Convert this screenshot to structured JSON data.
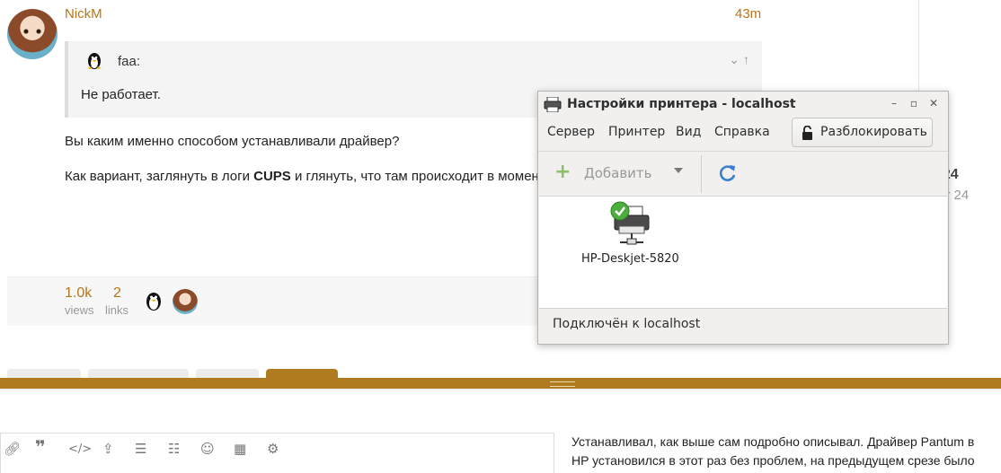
{
  "post": {
    "username": "NickM",
    "time": "43m",
    "quote_author": "faa:",
    "quote_text": "Не работает.",
    "paragraph1": "Вы каким именно способом устанавливали драйвер?",
    "paragraph2_before": "Как вариант, заглянуть в логи ",
    "paragraph2_bold": "CUPS",
    "paragraph2_after": " и глянуть, что там происходит в момент"
  },
  "timeline": {
    "progress": "/ 24",
    "date": "ar 24"
  },
  "stats": {
    "views_value": "1.0k",
    "views_label": "views",
    "links_value": "2",
    "links_label": "links"
  },
  "composer": {
    "preview_line1": "Устанавливал, как выше сам подробно описывал. Драйвер Pantum в",
    "preview_line2": "HP установился в этот раз без проблем, на предыдущем срезе было"
  },
  "dialog": {
    "title": "Настройки принтера - localhost",
    "menu": [
      "Сервер",
      "Принтер",
      "Вид",
      "Справка"
    ],
    "unlock_label": "Разблокировать",
    "add_label": "Добавить",
    "printer_name": "HP-Deskjet-5820",
    "status": "Подключён к localhost"
  },
  "colors": {
    "accent": "#b5761a",
    "divider": "#b07a1e"
  }
}
